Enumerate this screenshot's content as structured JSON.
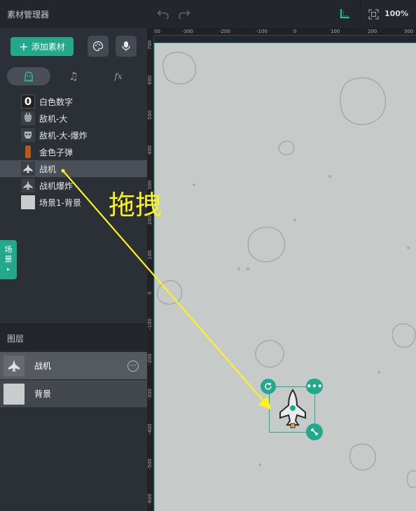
{
  "asset_panel": {
    "title": "素材管理器",
    "add_button": "添加素材",
    "tabs": [
      {
        "name": "costume-tab",
        "icon": "ghost-icon",
        "glyph": "👻"
      },
      {
        "name": "sound-tab",
        "icon": "music-note-icon",
        "glyph": "♫"
      },
      {
        "name": "function-tab",
        "icon": "fx-icon",
        "glyph": "fx"
      }
    ],
    "assets": [
      {
        "label": "白色数字",
        "thumb": "0"
      },
      {
        "label": "敌机-大",
        "thumb": "enemy"
      },
      {
        "label": "敌机-大-爆炸",
        "thumb": "enemy"
      },
      {
        "label": "金色子弹",
        "thumb": "bullet"
      },
      {
        "label": "战机",
        "thumb": "plane",
        "selected": true
      },
      {
        "label": "战机爆炸",
        "thumb": "plane"
      },
      {
        "label": "场景1-背景",
        "thumb": "bg"
      }
    ],
    "scene_tab": {
      "line1": "场",
      "line2": "景",
      "arrow": "▸"
    }
  },
  "layers_panel": {
    "title": "图层",
    "layers": [
      {
        "label": "战机",
        "more": "···",
        "selected": true
      },
      {
        "label": "背景"
      }
    ]
  },
  "toolbar": {
    "zoom": "100%"
  },
  "rulers": {
    "horizontal": [
      "00",
      "-300",
      "-200",
      "-100",
      "0",
      "100",
      "200",
      "300"
    ],
    "vertical": [
      "700",
      "600",
      "500",
      "400",
      "300",
      "200",
      "100",
      "0",
      "-100",
      "-200",
      "-300",
      "-400",
      "-500",
      "-600"
    ]
  },
  "annotation": {
    "drag_text": "拖拽"
  },
  "colors": {
    "accent": "#22a88a",
    "annotation": "#fdf21c",
    "stage": "#c6cbc9"
  }
}
